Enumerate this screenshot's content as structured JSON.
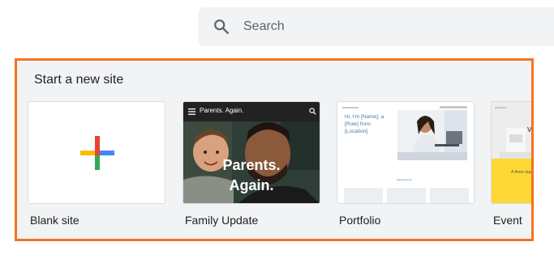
{
  "search": {
    "placeholder": "Search"
  },
  "gallery": {
    "title": "Start a new site",
    "templates": [
      {
        "label": "Blank site"
      },
      {
        "label": "Family Update",
        "brand": "Parents. Again.",
        "heading": "Parents. Again."
      },
      {
        "label": "Portfolio",
        "intro": "Hi, I'm [Name], a [Role] from [Location]."
      },
      {
        "label": "Event",
        "word": "ve",
        "subtext": "A three day"
      }
    ]
  },
  "colors": {
    "highlight_border": "#f47321",
    "gallery_bg": "#f1f3f4",
    "google_blue": "#4285f4",
    "google_red": "#ea4335",
    "google_yellow": "#fbbc04",
    "google_green": "#34a853",
    "event_yellow": "#fdd835"
  },
  "icons": {
    "search": "search-icon",
    "plus": "plus-icon",
    "menu": "menu-icon"
  }
}
